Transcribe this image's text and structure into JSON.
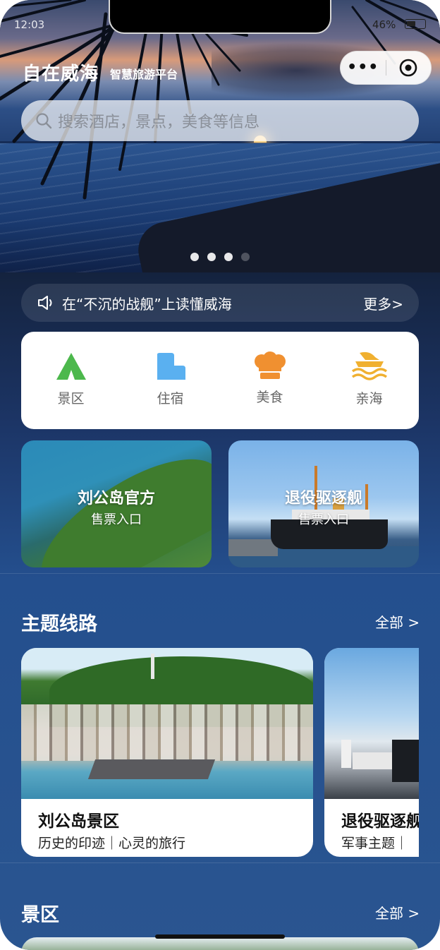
{
  "status_bar": {
    "time": "12:03",
    "battery": "46%"
  },
  "header": {
    "title": "自在威海",
    "subtitle": "智慧旅游平台",
    "capsule_more": "•••"
  },
  "search": {
    "placeholder": "搜索酒店，景点，美食等信息"
  },
  "carousel": {
    "count": 4,
    "active_index": 2
  },
  "notice": {
    "text": "在“不沉的战舰”上读懂威海",
    "more": "更多>"
  },
  "categories": [
    {
      "label": "景区",
      "icon": "tent-icon",
      "color": "#4cb84c"
    },
    {
      "label": "住宿",
      "icon": "building-icon",
      "color": "#5ab0f0"
    },
    {
      "label": "美食",
      "icon": "chef-hat-icon",
      "color": "#f09030"
    },
    {
      "label": "亲海",
      "icon": "wave-icon",
      "color": "#f0b030"
    }
  ],
  "tickets": [
    {
      "title": "刘公岛官方",
      "subtitle": "售票入口"
    },
    {
      "title": "退役驱逐舰",
      "subtitle": "售票入口"
    }
  ],
  "routes_section": {
    "title": "主题线路",
    "more": "全部 >",
    "items": [
      {
        "title": "刘公岛景区",
        "subtitle": "历史的印迹｜心灵的旅行"
      },
      {
        "title": "退役驱逐舰",
        "subtitle": "军事主题｜"
      }
    ]
  },
  "scenic_section": {
    "title": "景区",
    "more": "全部 >"
  },
  "colors": {
    "page_bg_top": "#0f1a2e",
    "page_bg_bottom": "#2a5590",
    "card_bg": "#ffffff"
  }
}
